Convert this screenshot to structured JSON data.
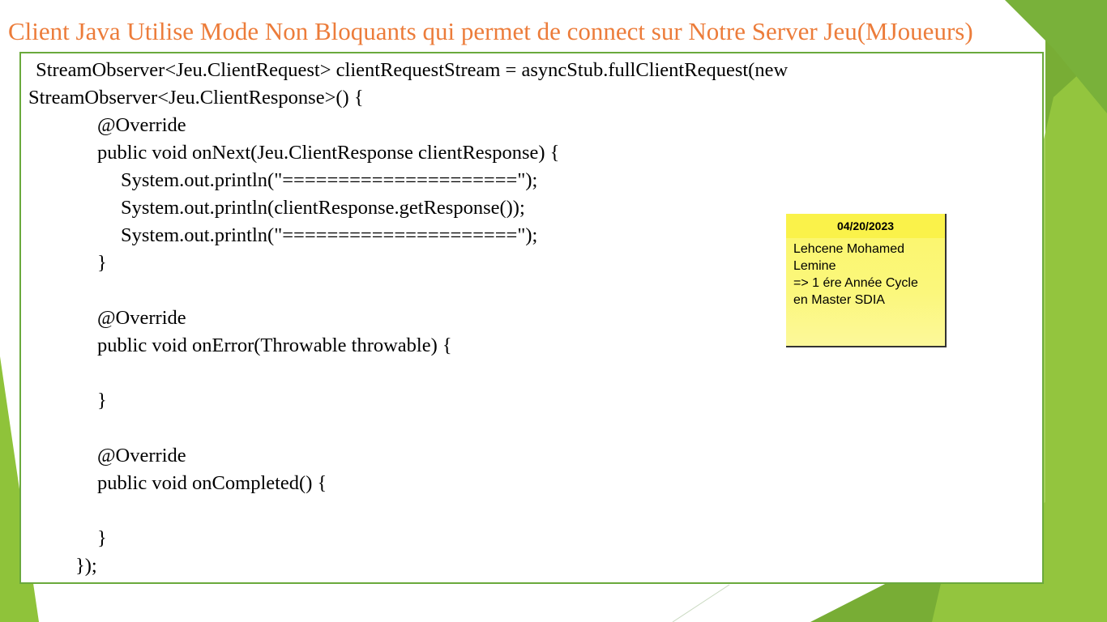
{
  "slide": {
    "title": "Client Java Utilise Mode Non Bloquants qui permet de connect sur Notre Server Jeu(MJoueurs)",
    "colors": {
      "title": "#ec7c3a",
      "accent_green": "#8fc33a",
      "frame_border": "#6aa93c",
      "note_yellow": "#fbf66a"
    }
  },
  "code": {
    "lines": [
      " StreamObserver<Jeu.ClientRequest> clientRequestStream = asyncStub.fullClientRequest(new",
      "StreamObserver<Jeu.ClientResponse>() {",
      "@Override",
      "public void onNext(Jeu.ClientResponse clientResponse) {",
      "System.out.println(\"=====================\");",
      "System.out.println(clientResponse.getResponse());",
      "System.out.println(\"=====================\");",
      "}",
      "@Override",
      "public void onError(Throwable throwable) {",
      "}",
      "@Override",
      "public void onCompleted() {",
      "}",
      "});"
    ]
  },
  "sticky_note": {
    "date": "04/20/2023",
    "lines": [
      "Lehcene Mohamed",
      "Lemine",
      "=> 1 ére Année Cycle",
      "en Master SDIA"
    ]
  }
}
